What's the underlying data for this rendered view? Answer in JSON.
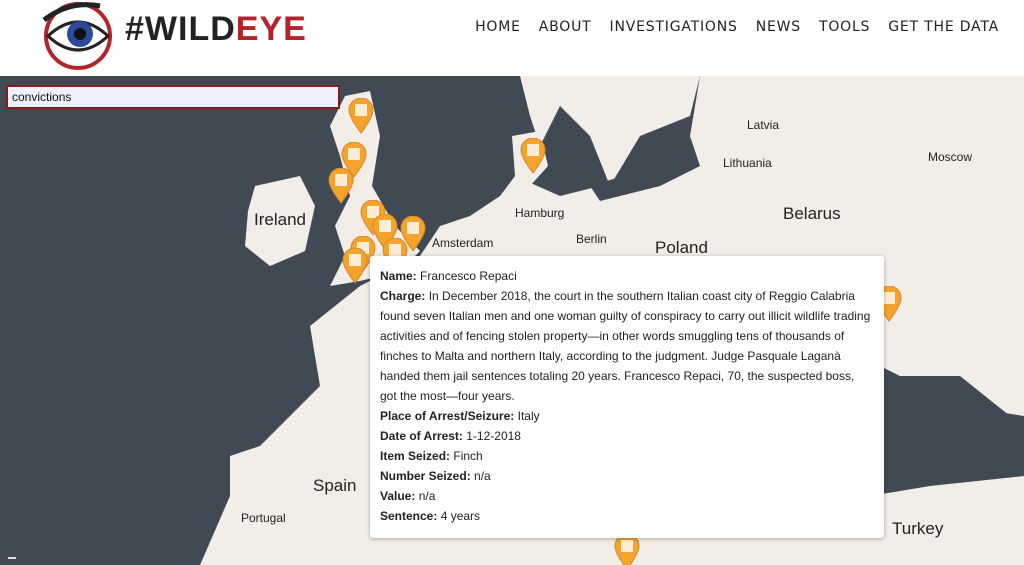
{
  "header": {
    "logo_text_dark": "#WILD",
    "logo_text_red": "EYE",
    "nav": [
      "HOME",
      "ABOUT",
      "INVESTIGATIONS",
      "NEWS",
      "TOOLS",
      "GET THE DATA"
    ]
  },
  "search": {
    "value": "convictions"
  },
  "map": {
    "places": {
      "ireland": "Ireland",
      "amsterdam": "Amsterdam",
      "hamburg": "Hamburg",
      "berlin": "Berlin",
      "poland": "Poland",
      "belarus": "Belarus",
      "latvia": "Latvia",
      "lithuania": "Lithuania",
      "moscow": "Moscow",
      "spain": "Spain",
      "portugal": "Portugal",
      "turkey": "Turkey"
    },
    "marker_icon": "marker-icon",
    "colors": {
      "water": "#3f4a55",
      "land": "#f2ede6",
      "marker": "#f4a42c"
    }
  },
  "popup": {
    "name_label": "Name:",
    "name": "Francesco Repaci",
    "charge_label": "Charge:",
    "charge": "In December 2018, the court in the southern Italian coast city of Reggio Calabria found seven Italian men and one woman guilty of conspiracy to carry out illicit wildlife trading activities and of fencing stolen property—in other words smuggling tens of thousands of finches to Malta and northern Italy, according to the judgment. Judge Pasquale Laganà handed them jail sentences totaling 20 years. Francesco Repaci, 70, the suspected boss, got the most—four years.",
    "place_label": "Place of Arrest/Seizure:",
    "place": "Italy",
    "date_label": "Date of Arrest:",
    "date": "1-12-2018",
    "item_label": "Item Seized:",
    "item": "Finch",
    "number_label": "Number Seized:",
    "number": "n/a",
    "value_label": "Value:",
    "value": "n/a",
    "sentence_label": "Sentence:",
    "sentence": "4 years"
  }
}
